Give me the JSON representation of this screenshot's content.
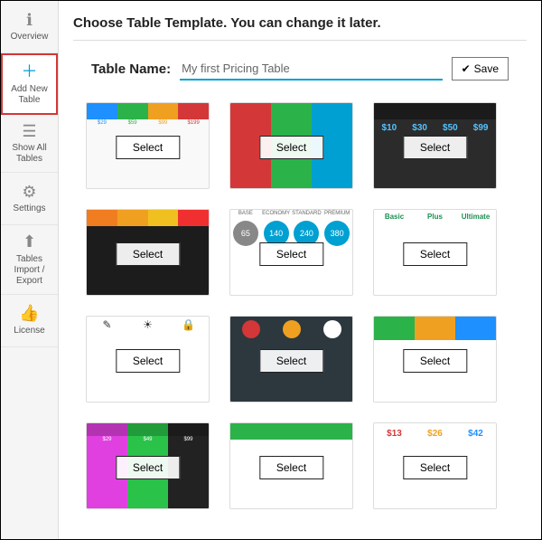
{
  "sidebar": {
    "items": [
      {
        "label": "Overview",
        "icon": "ℹ"
      },
      {
        "label": "Add New Table",
        "icon": "＋"
      },
      {
        "label": "Show All Tables",
        "icon": "☰"
      },
      {
        "label": "Settings",
        "icon": "⚙"
      },
      {
        "label": "Tables Import / Export",
        "icon": "⬆"
      },
      {
        "label": "License",
        "icon": "👍"
      }
    ]
  },
  "heading": "Choose Table Template. You can change it later.",
  "form": {
    "label": "Table Name:",
    "value": "My first Pricing Table",
    "save": "Save"
  },
  "select_label": "Select",
  "t1_prices": [
    "$29",
    "$59",
    "$99",
    "$199"
  ],
  "t3_prices": [
    "$10",
    "$30",
    "$50",
    "$99"
  ],
  "t5_vals": [
    "65",
    "140",
    "240",
    "380"
  ],
  "t5_heads": [
    "BASE",
    "ECONOMY",
    "STANDARD",
    "PREMIUM"
  ],
  "t10_prices": [
    "$29",
    "$49",
    "$99"
  ],
  "t12_prices": [
    "$13",
    "$26",
    "$42"
  ]
}
